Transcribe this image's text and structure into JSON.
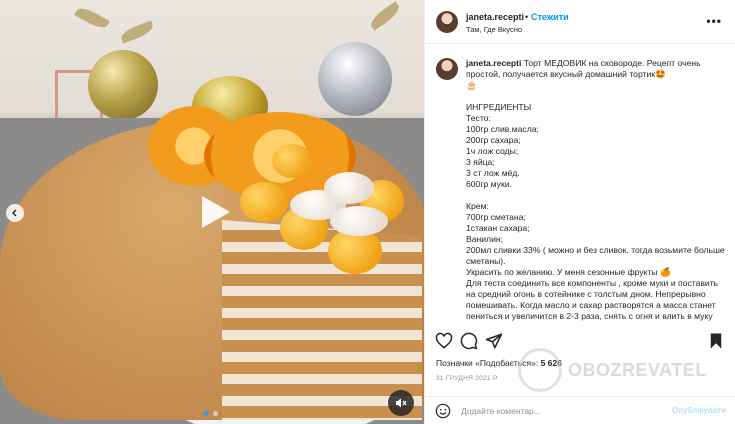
{
  "post": {
    "username": "janeta.recepti",
    "separator": "•",
    "follow_label": "Стежити",
    "location": "Там, Где Вкусно",
    "more_icon": "more-horizontal-icon"
  },
  "caption": {
    "username": "janeta.recepti",
    "text": " Торт МЕДОВИК на сковороде. Рецепт очень простой, получается вкусный домашний тортик🤩\n🎂\n\nИНГРЕДИЕНТЫ\nТесто:\n100гр слив.масла;\n200гр сахара;\n1ч лож соды;\n3 яйца;\n3 ст лож мёд.\n600гр муки.\n\nКрем:\n700гр сметана;\n1стакан сахара;\nВанилин;\n200мл сливки 33% ( можно и без сливок. тогда возьмите больше сметаны).\nУкрасить по желанию. У меня сезонные фрукты 🍊\nДля теста соединить все компоненты , кроме муки и поставить на средний огонь в сотейнике с толстым дном. Непрерывно помешивать. Когда масло и сахар растворятся а масса станет пениться и увеличится в 2-3 раза, снять с огня и влить в муку"
  },
  "actions": {
    "like_icon": "heart-icon",
    "comment_icon": "comment-icon",
    "share_icon": "send-icon",
    "save_icon": "bookmark-icon"
  },
  "likes": {
    "label": "Позначки «Подобається»:",
    "count": "5 626"
  },
  "date": "31 ГРУДНЯ 2021 Р.",
  "comment_box": {
    "emoji_icon": "smiley-icon",
    "placeholder": "Додайте коментар...",
    "post_label": "Опублікувати"
  },
  "media": {
    "play_icon": "play-icon",
    "prev_icon": "chevron-left-icon",
    "mute_icon": "speaker-muted-icon",
    "carousel_position": 1,
    "carousel_total": 2
  },
  "watermark": {
    "text": "OBOZREVATEL"
  }
}
